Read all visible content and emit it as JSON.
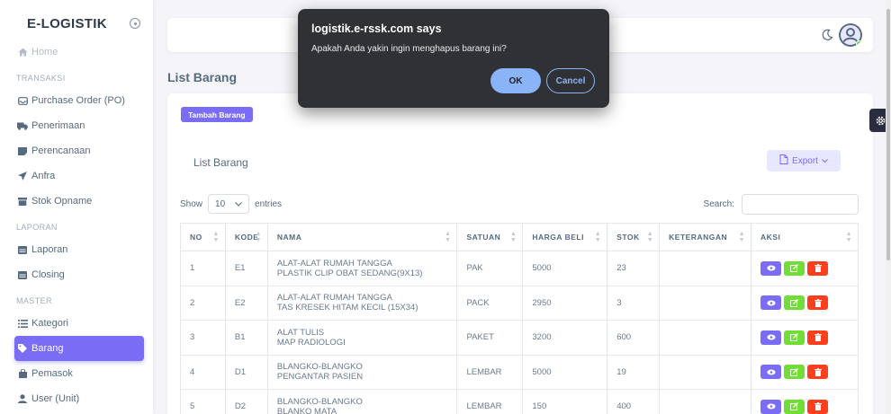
{
  "sidebar": {
    "brand": "E-LOGISTIK",
    "home": "Home",
    "sections": {
      "transaksi": "TRANSAKSI",
      "laporan": "LAPORAN",
      "master": "MASTER"
    },
    "items": {
      "po": "Purchase Order (PO)",
      "penerimaan": "Penerimaan",
      "perencanaan": "Perencanaan",
      "anfra": "Anfra",
      "stok_opname": "Stok Opname",
      "laporan": "Laporan",
      "closing": "Closing",
      "kategori": "Kategori",
      "barang": "Barang",
      "pemasok": "Pemasok",
      "user_unit": "User (Unit)"
    }
  },
  "page": {
    "heading": "List Barang",
    "add_button": "Tambah Barang",
    "card_title": "List Barang",
    "export_button": "Export",
    "show_label": "Show",
    "entries_select": "10",
    "entries_label": "entries",
    "search_label": "Search:"
  },
  "table": {
    "headers": [
      "NO",
      "KODE",
      "NAMA",
      "SATUAN",
      "HARGA BELI",
      "STOK",
      "KETERANGAN",
      "AKSI"
    ],
    "rows": [
      {
        "no": "1",
        "kode": "E1",
        "nama1": "ALAT-ALAT RUMAH TANGGA",
        "nama2": "PLASTIK CLIP OBAT SEDANG(9X13)",
        "satuan": "PAK",
        "harga": "5000",
        "stok": "23",
        "ket": ""
      },
      {
        "no": "2",
        "kode": "E2",
        "nama1": "ALAT-ALAT RUMAH TANGGA",
        "nama2": "TAS KRESEK HITAM KECIL (15X34)",
        "satuan": "PACK",
        "harga": "2950",
        "stok": "3",
        "ket": ""
      },
      {
        "no": "3",
        "kode": "B1",
        "nama1": "ALAT TULIS",
        "nama2": "MAP RADIOLOGI",
        "satuan": "PAKET",
        "harga": "3200",
        "stok": "600",
        "ket": ""
      },
      {
        "no": "4",
        "kode": "D1",
        "nama1": "BLANGKO-BLANGKO",
        "nama2": "PENGANTAR PASIEN",
        "satuan": "LEMBAR",
        "harga": "5000",
        "stok": "19",
        "ket": ""
      },
      {
        "no": "5",
        "kode": "D2",
        "nama1": "BLANGKO-BLANGKO",
        "nama2": "BLANKO MATA",
        "satuan": "LEMBAR",
        "harga": "150",
        "stok": "400",
        "ket": ""
      }
    ]
  },
  "dialog": {
    "title": "logistik.e-rssk.com says",
    "message": "Apakah Anda yakin ingin menghapus barang ini?",
    "ok": "OK",
    "cancel": "Cancel"
  },
  "colors": {
    "primary": "#7b6cf6",
    "success": "#71dd37",
    "danger": "#ff3e1d",
    "dialog_bg": "#303134",
    "dialog_accent": "#8ab4f8"
  }
}
